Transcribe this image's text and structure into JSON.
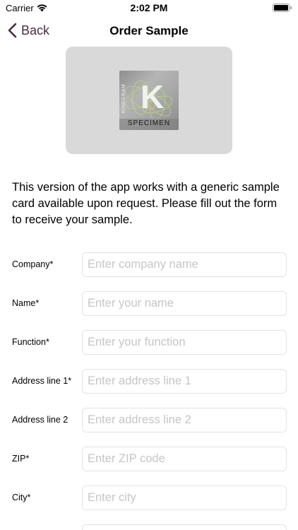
{
  "status_bar": {
    "carrier": "Carrier",
    "time": "2:02 PM"
  },
  "nav": {
    "back_label": "Back",
    "title": "Order Sample"
  },
  "card": {
    "logo_letter": "K",
    "brand_text": "KINEGRAM",
    "specimen_label": "SPECIMEN"
  },
  "intro_text": "This version of the app works with a generic sample card available upon request. Please fill out the form to receive your sample.",
  "form": {
    "fields": [
      {
        "label": "Company*",
        "placeholder": "Enter company name",
        "value": ""
      },
      {
        "label": "Name*",
        "placeholder": "Enter your name",
        "value": ""
      },
      {
        "label": "Function*",
        "placeholder": "Enter your function",
        "value": ""
      },
      {
        "label": "Address line 1*",
        "placeholder": "Enter address line 1",
        "value": ""
      },
      {
        "label": "Address line 2",
        "placeholder": "Enter address line 2",
        "value": ""
      },
      {
        "label": "ZIP*",
        "placeholder": "Enter ZIP code",
        "value": ""
      },
      {
        "label": "City*",
        "placeholder": "Enter city",
        "value": ""
      }
    ]
  },
  "colors": {
    "accent": "#4a2a45",
    "card_bg": "#d9d9d9",
    "placeholder": "#c6c6c8",
    "field_border": "#e3e3e3"
  }
}
